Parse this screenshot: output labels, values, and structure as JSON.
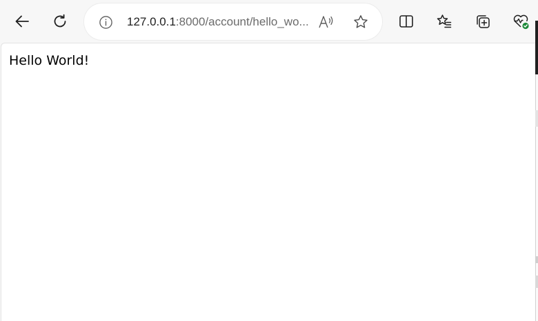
{
  "browser": {
    "address_bar": {
      "url_host": "127.0.0.1",
      "url_rest": ":8000/account/hello_wo..."
    },
    "icons": {
      "back": "back-arrow-icon",
      "reload": "reload-icon",
      "info": "info-icon",
      "read_aloud": "read-aloud-icon",
      "favorite": "star-icon",
      "split_screen": "split-screen-icon",
      "favorites": "favorites-icon",
      "collections": "collections-icon",
      "browser_essentials": "browser-essentials-icon"
    },
    "colors": {
      "toolbar_bg": "#f7f7f7",
      "address_bg": "#ffffff",
      "health_badge": "#1d8a3a"
    }
  },
  "page": {
    "text": "Hello World!"
  }
}
